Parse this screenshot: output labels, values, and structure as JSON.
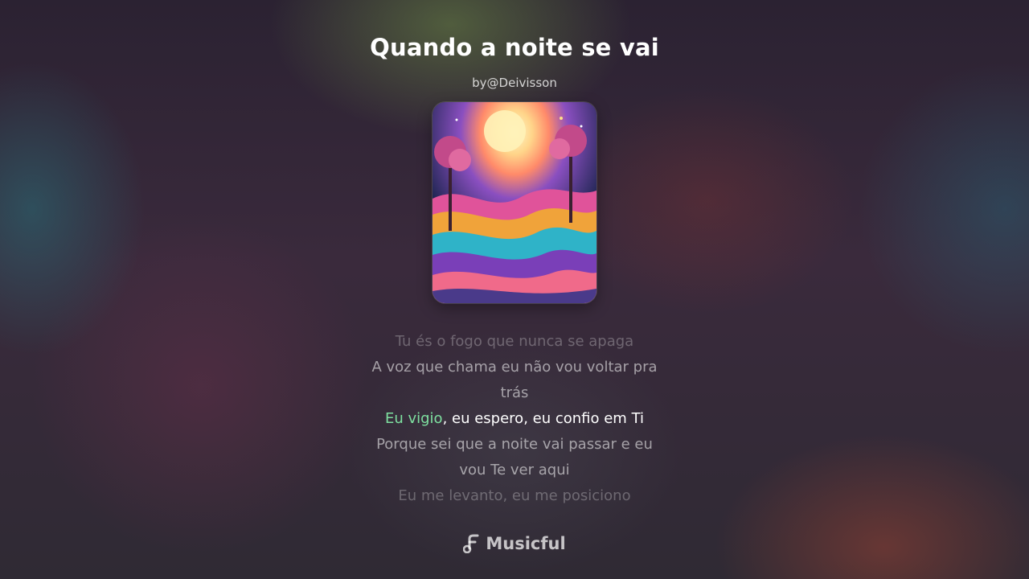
{
  "song": {
    "title": "Quando a noite se vai",
    "author": "by@Deivisson"
  },
  "cover": {
    "icon": "album-art-landscape"
  },
  "lyrics": {
    "lines": [
      "Tu és o fogo que nunca se apaga",
      "A voz que chama eu não vou voltar pra trás",
      ", eu espero, eu confio em Ti",
      "Porque sei que a noite vai passar e eu vou Te ver aqui",
      "Eu me levanto, eu me posiciono"
    ],
    "active_highlight": "Eu vigio"
  },
  "brand": {
    "name": "Musicful",
    "icon": "music-note-logo"
  },
  "colors": {
    "highlight": "#7ee0a0"
  }
}
